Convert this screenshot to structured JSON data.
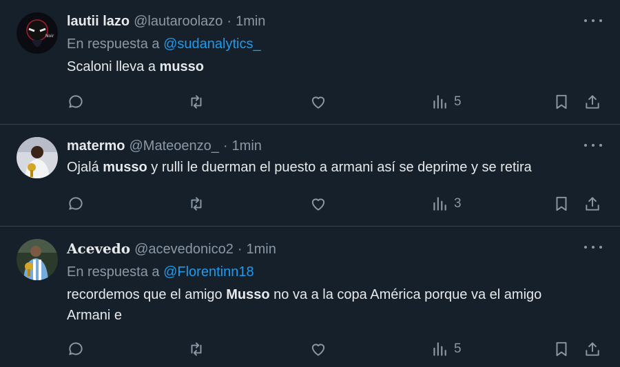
{
  "tweets": [
    {
      "name": "lautii lazo",
      "handle": "@lautaroolazo",
      "dot": "·",
      "time": "1min",
      "reply_prefix": "En respuesta a",
      "reply_to": "@sudanalytics_",
      "text_before": "Scaloni lleva a ",
      "text_bold": "musso",
      "text_after": "",
      "views": "5"
    },
    {
      "name": "matermo",
      "handle": "@Mateoenzo_",
      "dot": "·",
      "time": "1min",
      "text_before": "Ojalá ",
      "text_bold": "musso",
      "text_after": " y rulli le duerman el puesto a armani así se deprime y se retira",
      "views": "3"
    },
    {
      "name": "Acevedo",
      "handle": "@acevedonico2",
      "dot": "·",
      "time": "1min",
      "reply_prefix": "En respuesta a",
      "reply_to": "@Florentinn18",
      "text_before": "recordemos que el amigo ",
      "text_bold": "Musso",
      "text_after": " no va a la copa América porque va el amigo Armani e",
      "views": "5"
    }
  ],
  "colors": {
    "background": "#15202b",
    "divider": "#38444d",
    "muted": "#8b98a5",
    "link": "#1d9bf0",
    "text": "#e7e9ea"
  },
  "icons": [
    "reply-icon",
    "retweet-icon",
    "like-icon",
    "views-icon",
    "bookmark-icon",
    "share-icon",
    "more-icon"
  ]
}
